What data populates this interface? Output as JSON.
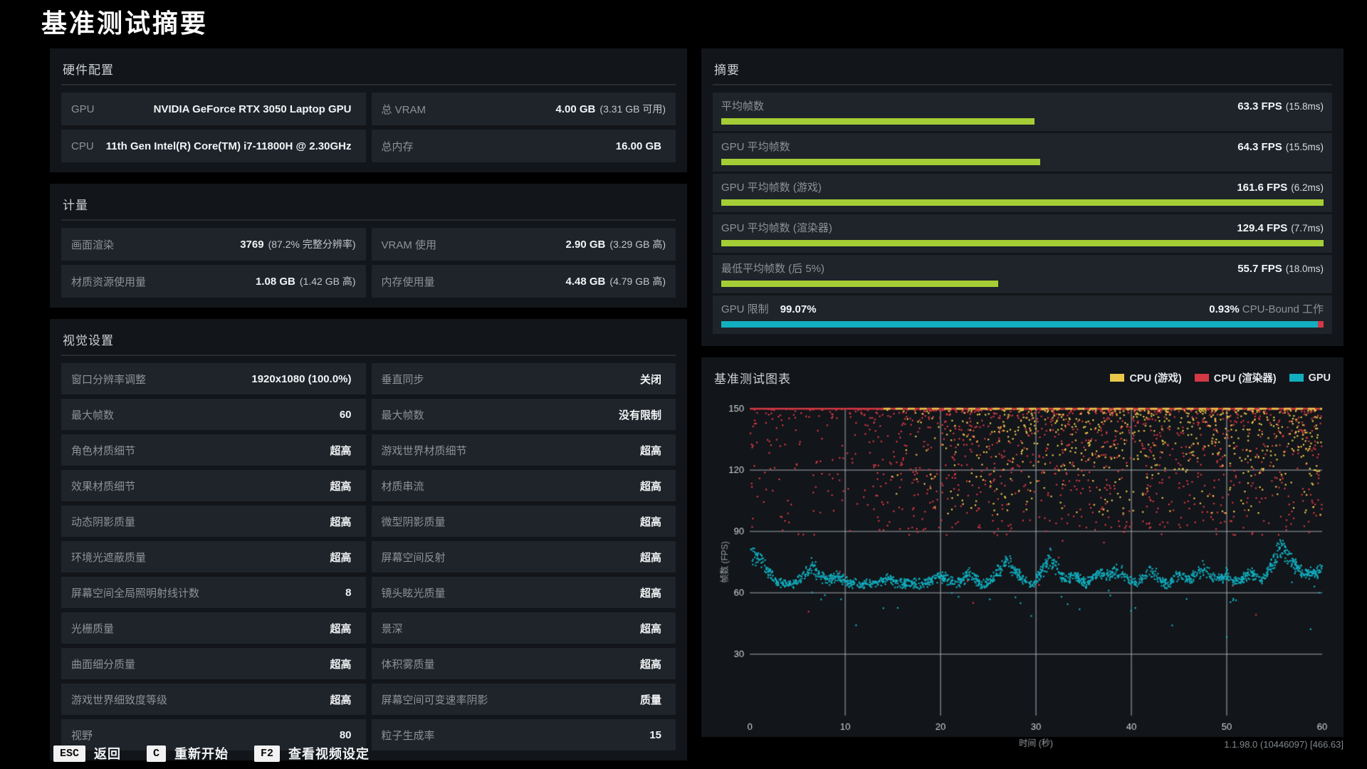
{
  "title": "基准测试摘要",
  "colors": {
    "green_bar": "#a5cd35",
    "teal": "#12afc0",
    "red": "#d43845",
    "yellow": "#e9c84a",
    "panel_bg": "#121519",
    "row_bg": "#1e242a"
  },
  "panels": {
    "hardware": {
      "title": "硬件配置",
      "cells": [
        {
          "label": "GPU",
          "value": "NVIDIA GeForce RTX 3050 Laptop GPU"
        },
        {
          "label": "总 VRAM",
          "value": "4.00 GB",
          "suffix": "(3.31 GB 可用)"
        },
        {
          "label": "CPU",
          "value": "11th Gen Intel(R) Core(TM) i7-11800H @ 2.30GHz"
        },
        {
          "label": "总内存",
          "value": "16.00 GB"
        }
      ]
    },
    "metrics": {
      "title": "计量",
      "cells": [
        {
          "label": "画面渲染",
          "value": "3769",
          "suffix": "(87.2% 完整分辨率)"
        },
        {
          "label": "VRAM 使用",
          "value": "2.90 GB",
          "suffix": "(3.29 GB 高)"
        },
        {
          "label": "材质资源使用量",
          "value": "1.08 GB",
          "suffix": "(1.42 GB 高)"
        },
        {
          "label": "内存使用量",
          "value": "4.48 GB",
          "suffix": "(4.79 GB 高)"
        }
      ]
    },
    "visual": {
      "title": "视觉设置",
      "cells": [
        {
          "label": "窗口分辨率调整",
          "value": "1920x1080 (100.0%)"
        },
        {
          "label": "垂直同步",
          "value": "关闭"
        },
        {
          "label": "最大帧数",
          "value": "60"
        },
        {
          "label": "最大帧数",
          "value": "没有限制"
        },
        {
          "label": "角色材质细节",
          "value": "超高"
        },
        {
          "label": "游戏世界材质细节",
          "value": "超高"
        },
        {
          "label": "效果材质细节",
          "value": "超高"
        },
        {
          "label": "材质串流",
          "value": "超高"
        },
        {
          "label": "动态阴影质量",
          "value": "超高"
        },
        {
          "label": "微型阴影质量",
          "value": "超高"
        },
        {
          "label": "环境光遮蔽质量",
          "value": "超高"
        },
        {
          "label": "屏幕空间反射",
          "value": "超高"
        },
        {
          "label": "屏幕空间全局照明射线计数",
          "value": "8"
        },
        {
          "label": "镜头眩光质量",
          "value": "超高"
        },
        {
          "label": "光栅质量",
          "value": "超高"
        },
        {
          "label": "景深",
          "value": "超高"
        },
        {
          "label": "曲面细分质量",
          "value": "超高"
        },
        {
          "label": "体积雾质量",
          "value": "超高"
        },
        {
          "label": "游戏世界细致度等级",
          "value": "超高"
        },
        {
          "label": "屏幕空间可变速率阴影",
          "value": "质量"
        },
        {
          "label": "视野",
          "value": "80"
        },
        {
          "label": "粒子生成率",
          "value": "15"
        }
      ]
    },
    "summary": {
      "title": "摘要",
      "items": [
        {
          "label": "平均帧数",
          "value": "63.3 FPS",
          "suffix": "(15.8ms)",
          "bar_pct": 52
        },
        {
          "label": "GPU 平均帧数",
          "value": "64.3 FPS",
          "suffix": "(15.5ms)",
          "bar_pct": 53
        },
        {
          "label": "GPU 平均帧数 (游戏)",
          "value": "161.6 FPS",
          "suffix": "(6.2ms)",
          "bar_pct": 100
        },
        {
          "label": "GPU 平均帧数 (渲染器)",
          "value": "129.4 FPS",
          "suffix": "(7.7ms)",
          "bar_pct": 100
        },
        {
          "label": "最低平均帧数 (后 5%)",
          "value": "55.7 FPS",
          "suffix": "(18.0ms)",
          "bar_pct": 46
        }
      ],
      "gpu_bound": {
        "label": "GPU 限制",
        "gpu_value": "99.07%",
        "cpu_value": "0.93%",
        "cpu_label": "CPU-Bound 工作",
        "gpu_pct": 99.07
      }
    }
  },
  "chart_data": {
    "type": "scatter",
    "title": "基准测试图表",
    "xlabel": "时间 (秒)",
    "ylabel": "帧数 (FPS)",
    "xlim": [
      0,
      60
    ],
    "ylim": [
      0,
      150
    ],
    "xticks": [
      0,
      10,
      20,
      30,
      40,
      50,
      60
    ],
    "yticks": [
      30,
      60,
      90,
      120,
      150
    ],
    "grid": true,
    "legend_position": "top-right",
    "note": "per-frame FPS scatter over a 60s benchmark; CPU series clip at 150 FPS forming a solid line; GPU band ~60-68 FPS with periodic spikes",
    "series": [
      {
        "id": "cpu-game",
        "name": "CPU (游戏)",
        "color": "#e9c84a",
        "count": 950,
        "model": {
          "t_min": 13,
          "t_max": 60,
          "ramp_span": 12,
          "top": 150,
          "spread": 52,
          "power": 2,
          "line_frac": 0.12,
          "extra_top_frac": 0.3,
          "extra_top_after": 30,
          "extra_top_span": 25
        }
      },
      {
        "id": "cpu-render",
        "name": "CPU (渲染器)",
        "color": "#d43845",
        "count": 1600,
        "model": {
          "t_min": 0,
          "t_max": 60,
          "top": 150,
          "spread": 62,
          "power": 2,
          "line_frac": 0.1,
          "sparse_before": 13,
          "sparse_keep": 0.5,
          "low_frac": 0.015,
          "low_min": 45,
          "low_span": 55
        }
      },
      {
        "id": "gpu",
        "name": "GPU",
        "color": "#12afc0",
        "count": 1700,
        "model": {
          "base": 61.5,
          "jitter": 3,
          "dip_frac": 0.02,
          "dip_span": 10,
          "out_frac": 0.002,
          "out_min": 36,
          "out_span": 10,
          "spikes": [
            [
              0,
              22,
              3
            ],
            [
              6.5,
              11,
              1.8
            ],
            [
              9,
              5,
              1.5
            ],
            [
              14.5,
              4,
              1.2
            ],
            [
              20,
              5,
              1.5
            ],
            [
              23,
              6,
              1.2
            ],
            [
              27,
              13,
              2.2
            ],
            [
              31.5,
              16,
              1.8
            ],
            [
              34,
              6,
              1.2
            ],
            [
              36.5,
              7,
              1.3
            ],
            [
              38.5,
              9,
              1.8
            ],
            [
              42,
              8,
              1.5
            ],
            [
              45,
              6,
              1.2
            ],
            [
              47.5,
              9,
              2
            ],
            [
              50,
              6,
              1.2
            ],
            [
              52.5,
              7,
              1.5
            ],
            [
              55.8,
              24,
              2.2
            ],
            [
              58,
              6,
              1.5
            ],
            [
              60,
              10,
              2
            ]
          ]
        }
      }
    ],
    "clip_lines": [
      {
        "series": "CPU (渲染器)",
        "color": "#d43845",
        "t": [
          0,
          60
        ],
        "dash": null
      },
      {
        "series": "CPU (游戏)",
        "color": "#e9c84a",
        "t": [
          14,
          60
        ],
        "dash": [
          10,
          7
        ]
      }
    ]
  },
  "footer": {
    "shortcuts": [
      {
        "key": "ESC",
        "label": "返回"
      },
      {
        "key": "C",
        "label": "重新开始"
      },
      {
        "key": "F2",
        "label": "查看视频设定"
      }
    ],
    "version": "1.1.98.0 (10446097) [466.63]"
  }
}
